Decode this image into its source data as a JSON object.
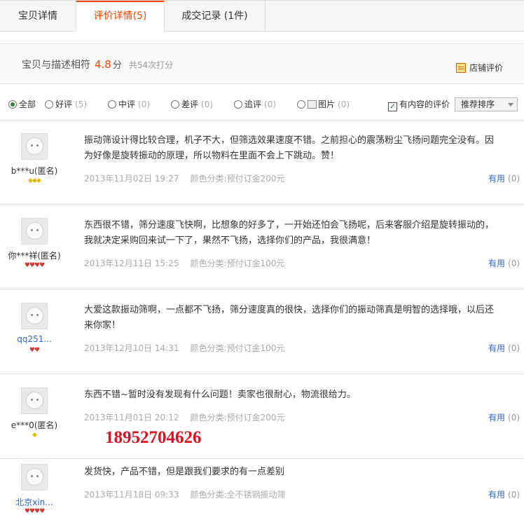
{
  "tabs": [
    {
      "label": "宝贝详情"
    },
    {
      "label": "评价详情",
      "count": "(5)"
    },
    {
      "label": "成交记录",
      "count_text": "(1件)"
    }
  ],
  "summary": {
    "label": "宝贝与描述相符",
    "score": "4.8",
    "unit": "分",
    "total": "共54次打分",
    "shop_link": "店铺评价"
  },
  "filters": {
    "all": "全部",
    "good": "好评",
    "good_count": "(5)",
    "mid": "中评",
    "mid_count": "(0)",
    "bad": "差评",
    "bad_count": "(0)",
    "append": "追评",
    "append_count": "(0)",
    "pic": "图片",
    "pic_count": "(0)",
    "has_content": "有内容的评价",
    "sort": "推荐排序"
  },
  "reviews": [
    {
      "user": "b***u(匿名)",
      "rank": "◆◆◆",
      "line1": "振动筛设计得比较合理，机子不大，但筛选效果速度不错。之前担心的震荡粉尘飞扬问题完全没有。因",
      "line2": "为好像是旋转振动的原理，所以物料在里面不会上下跳动。赞！",
      "date": "2013年11月02日 19:27",
      "sku": "颜色分类:预付订金200元",
      "useful": "有用",
      "useful_count": "(0)"
    },
    {
      "user": "你***祥(匿名)",
      "rank": "♥♥♥♥",
      "line1": "东西很不错，筛分速度飞快啊，比想象的好多了，一开始还怕会飞扬呢，后来客服介绍是旋转振动的，",
      "line2": "我就决定采购回来试一下了，果然不飞扬，选择你们的产品，我很满意！",
      "date": "2013年12月11日 15:25",
      "sku": "颜色分类:预付订金100元",
      "useful": "有用",
      "useful_count": "(0)"
    },
    {
      "user": "qq251...",
      "rank": "♥♥",
      "line1": "大爱这款振动筛啊，一点都不飞扬，筛分速度真的很快，选择你们的振动筛真是明智的选择哦，以后还",
      "line2": "来你家！",
      "date": "2013年12月10日 14:31",
      "sku": "颜色分类:预付订金100元",
      "useful": "有用",
      "useful_count": "(0)"
    },
    {
      "user": "e***0(匿名)",
      "rank": "◆",
      "line1": "东西不错~暂时没有发现有什么问题！卖家也很耐心，物流很给力。",
      "line2": "",
      "date": "2013年11月01日 20:12",
      "sku": "颜色分类:预付订金200元",
      "useful": "有用",
      "useful_count": "(0)"
    },
    {
      "user": "北京xin...",
      "rank": "♥♥♥♥",
      "line1": "发货快，产品不错，但是跟我们要求的有一点差别",
      "line2": "",
      "date": "2013年11月18日 09:33",
      "sku": "颜色分类:全不锈钢振动筛",
      "useful": "有用",
      "useful_count": "(0)"
    }
  ],
  "overlay_phone": "18952704626",
  "colors": {
    "accent": "#ff4400",
    "link": "#3366cc",
    "phone": "#e01020"
  }
}
